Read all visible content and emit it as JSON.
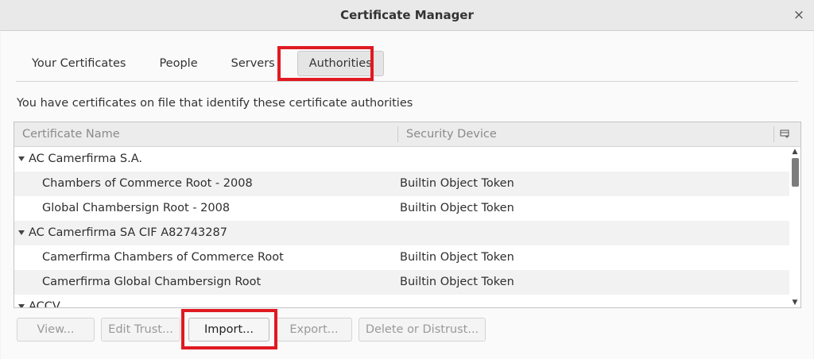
{
  "window": {
    "title": "Certificate Manager",
    "close_glyph": "×"
  },
  "tabs": [
    {
      "label": "Your Certificates"
    },
    {
      "label": "People"
    },
    {
      "label": "Servers"
    },
    {
      "label": "Authorities",
      "selected": true
    }
  ],
  "description": "You have certificates on file that identify these certificate authorities",
  "tree": {
    "columns": [
      "Certificate Name",
      "Security Device"
    ],
    "rows": [
      {
        "type": "group",
        "name": "AC Camerfirma S.A.",
        "device": ""
      },
      {
        "type": "item",
        "name": "Chambers of Commerce Root - 2008",
        "device": "Builtin Object Token"
      },
      {
        "type": "item",
        "name": "Global Chambersign Root - 2008",
        "device": "Builtin Object Token"
      },
      {
        "type": "group",
        "name": "AC Camerfirma SA CIF A82743287",
        "device": ""
      },
      {
        "type": "item",
        "name": "Camerfirma Chambers of Commerce Root",
        "device": "Builtin Object Token"
      },
      {
        "type": "item",
        "name": "Camerfirma Global Chambersign Root",
        "device": "Builtin Object Token"
      },
      {
        "type": "group",
        "name": "ACCV",
        "device": ""
      }
    ]
  },
  "buttons": {
    "view": {
      "label": "View..."
    },
    "edit_trust": {
      "label": "Edit Trust..."
    },
    "import": {
      "label": "Import..."
    },
    "export": {
      "label": "Export..."
    },
    "delete": {
      "label": "Delete or Distrust..."
    }
  },
  "highlight_color": "#e01a22"
}
